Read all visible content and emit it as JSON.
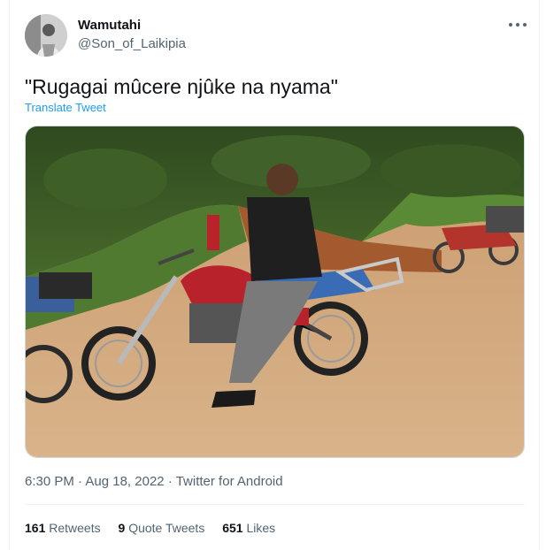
{
  "author": {
    "display_name": "Wamutahi",
    "handle": "@Son_of_Laikipia"
  },
  "tweet": {
    "text": "\"Rugagai mûcere njûke na nyama\"",
    "translate_label": "Translate Tweet"
  },
  "meta": {
    "time": "6:30 PM",
    "separator": "·",
    "date": "Aug 18, 2022",
    "source": "Twitter for Android"
  },
  "stats": [
    {
      "count": "161",
      "label": "Retweets"
    },
    {
      "count": "9",
      "label": "Quote Tweets"
    },
    {
      "count": "651",
      "label": "Likes"
    }
  ],
  "icons": {
    "more": "more-horizontal-icon"
  },
  "colors": {
    "link": "#1d9bf0",
    "secondary_text": "#536471",
    "primary_text": "#0f1419"
  }
}
